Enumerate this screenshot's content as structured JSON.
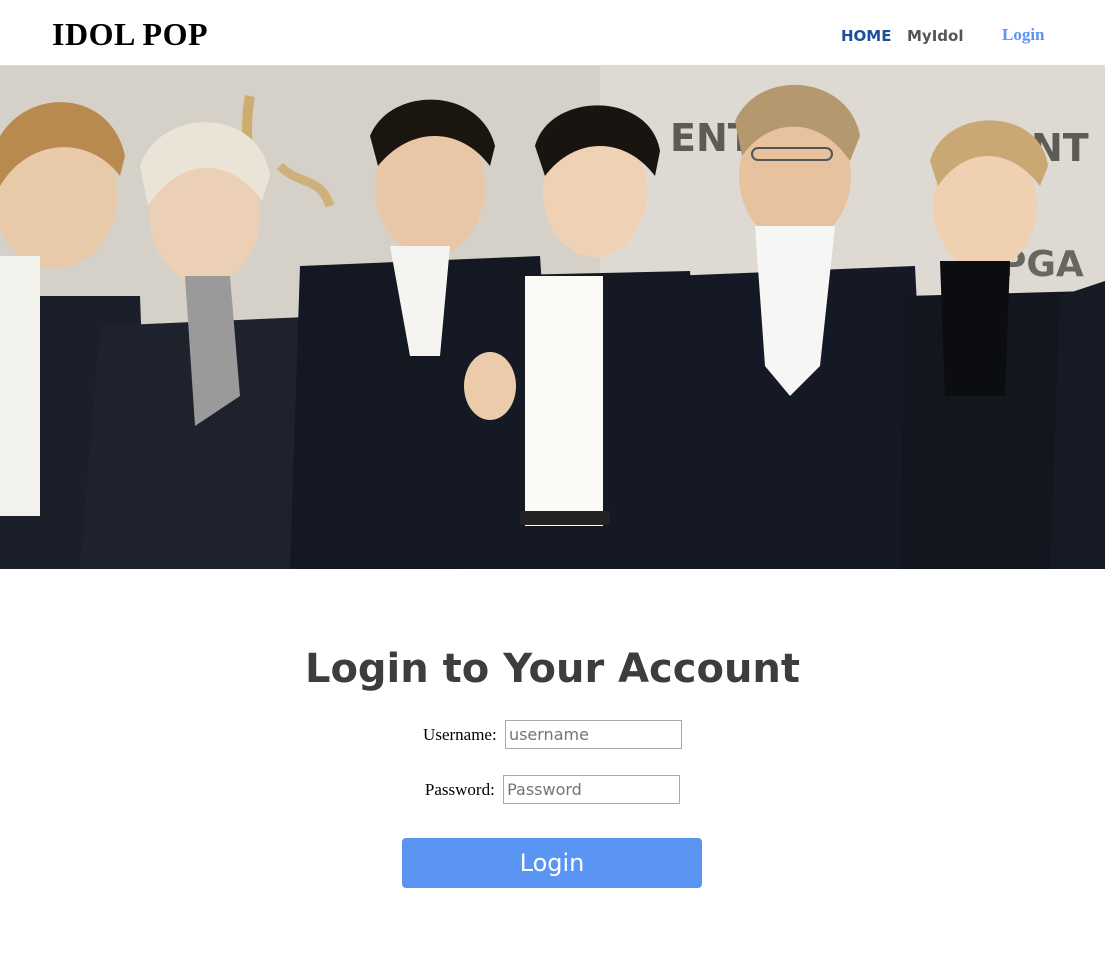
{
  "navbar": {
    "brand": "IDOL POP",
    "links": [
      {
        "label": "HOME",
        "color": "#1d4fa0"
      },
      {
        "label": "MyIdol",
        "color": "#555555"
      },
      {
        "label": "Login",
        "color": "#5b95f0"
      }
    ]
  },
  "hero": {
    "image": "group-photo-idols",
    "background_signage": [
      "ENT",
      "ENT",
      "PGA"
    ]
  },
  "login": {
    "title": "Login to Your Account",
    "username_label": "Username:",
    "username_placeholder": "username",
    "username_value": "",
    "password_label": "Password:",
    "password_placeholder": "Password",
    "password_value": "",
    "submit_label": "Login",
    "accent_color": "#5b95f3"
  }
}
